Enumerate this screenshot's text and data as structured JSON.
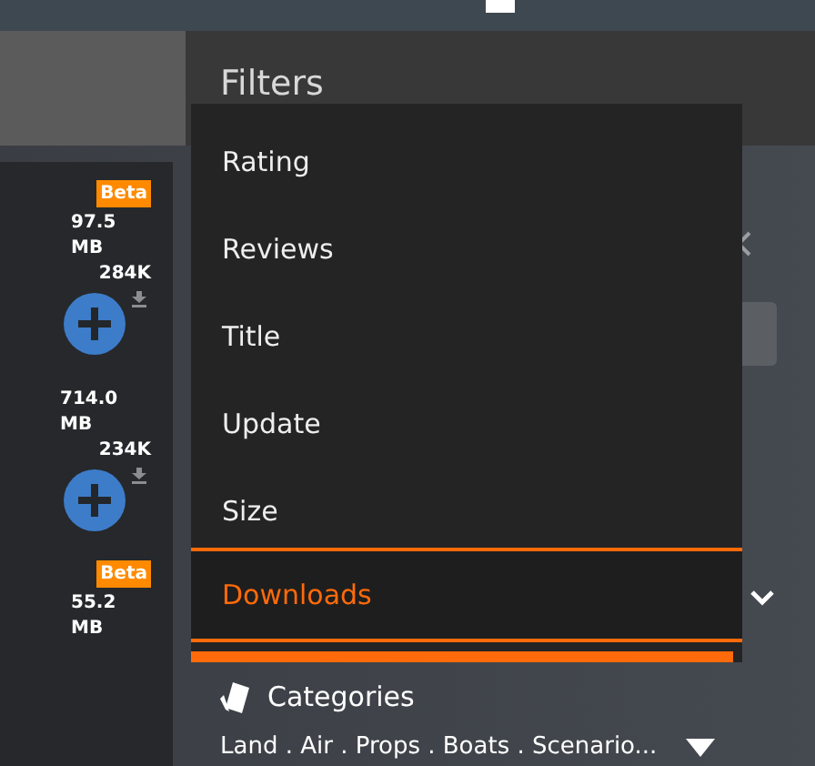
{
  "header": {
    "title": "Filters"
  },
  "items": [
    {
      "badge": "Beta",
      "size": "97.5 MB",
      "count": "284K"
    },
    {
      "size": "714.0 MB",
      "count": "234K"
    },
    {
      "badge": "Beta",
      "size": "55.2 MB"
    }
  ],
  "menu": [
    {
      "label": "Rating",
      "selected": false
    },
    {
      "label": "Reviews",
      "selected": false
    },
    {
      "label": "Title",
      "selected": false
    },
    {
      "label": "Update",
      "selected": false
    },
    {
      "label": "Size",
      "selected": false
    },
    {
      "label": "Downloads",
      "selected": true
    }
  ],
  "categories": {
    "label": "Categories",
    "value": "Land . Air . Props . Boats . Scenario..."
  }
}
